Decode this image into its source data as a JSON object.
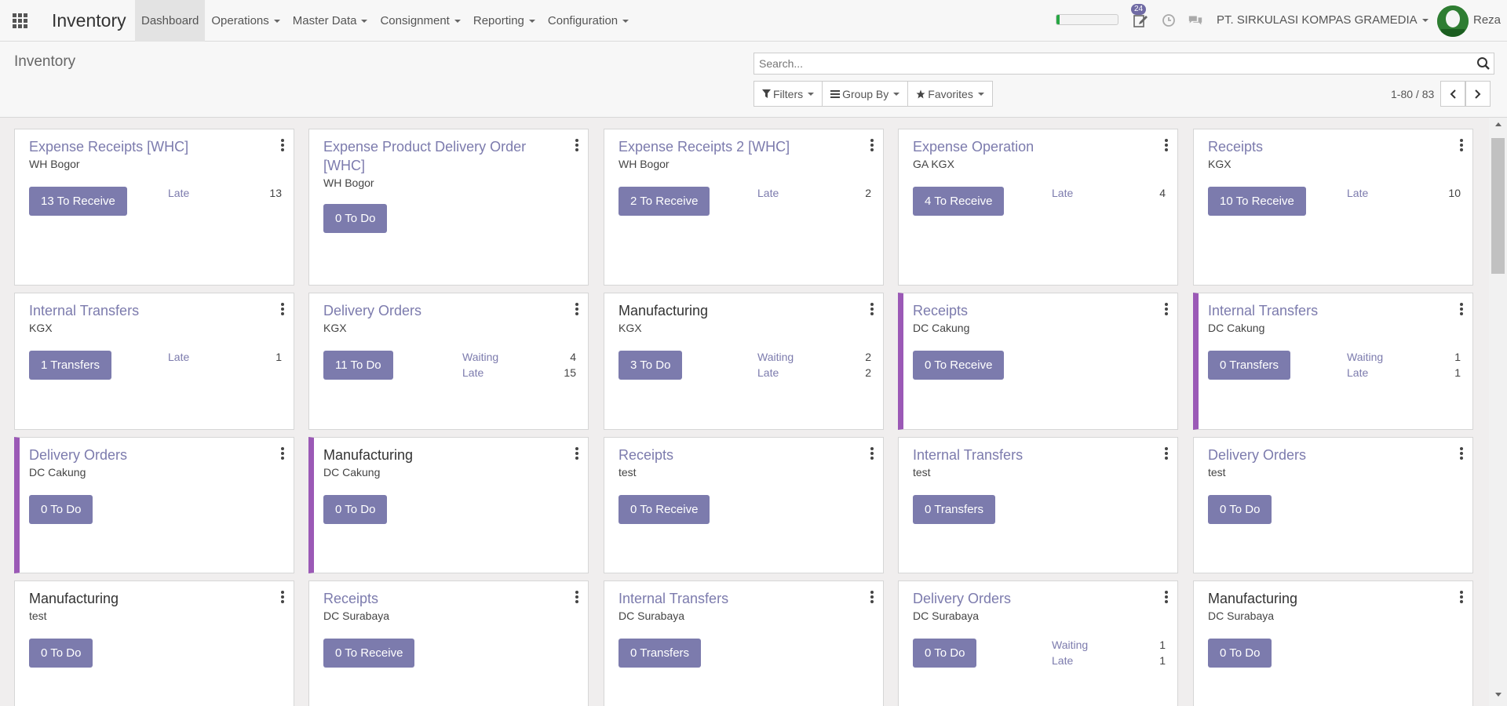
{
  "navbar": {
    "brand": "Inventory",
    "menu": [
      {
        "label": "Dashboard",
        "active": true,
        "dropdown": false
      },
      {
        "label": "Operations",
        "dropdown": true
      },
      {
        "label": "Master Data",
        "dropdown": true
      },
      {
        "label": "Consignment",
        "dropdown": true
      },
      {
        "label": "Reporting",
        "dropdown": true
      },
      {
        "label": "Configuration",
        "dropdown": true
      }
    ],
    "activity_badge": "24",
    "progress": 0.05,
    "company": "PT. SIRKULASI KOMPAS GRAMEDIA",
    "user": "Reza"
  },
  "control_panel": {
    "title": "Inventory",
    "search_placeholder": "Search...",
    "filters_label": "Filters",
    "groupby_label": "Group By",
    "favorites_label": "Favorites",
    "pager": "1-80 / 83"
  },
  "colors": {
    "accent": "#7c7bad",
    "stripe": "#9b59b6",
    "brand_green": "#28a745"
  },
  "cards": [
    {
      "title": "Expense Receipts [WHC]",
      "subtitle": "WH Bogor",
      "button": "13 To Receive",
      "stats": [
        {
          "label": "Late",
          "value": "13"
        }
      ]
    },
    {
      "title": "Expense Product Delivery Order [WHC]",
      "subtitle": "WH Bogor",
      "button": "0 To Do",
      "stats": []
    },
    {
      "title": "Expense Receipts 2 [WHC]",
      "subtitle": "WH Bogor",
      "button": "2 To Receive",
      "stats": [
        {
          "label": "Late",
          "value": "2"
        }
      ]
    },
    {
      "title": "Expense Operation",
      "subtitle": "GA KGX",
      "button": "4 To Receive",
      "stats": [
        {
          "label": "Late",
          "value": "4"
        }
      ]
    },
    {
      "title": "Receipts",
      "subtitle": "KGX",
      "button": "10 To Receive",
      "stats": [
        {
          "label": "Late",
          "value": "10"
        }
      ]
    },
    {
      "title": "Internal Transfers",
      "subtitle": "KGX",
      "button": "1 Transfers",
      "stats": [
        {
          "label": "Late",
          "value": "1"
        }
      ]
    },
    {
      "title": "Delivery Orders",
      "subtitle": "KGX",
      "button": "11 To Do",
      "stats": [
        {
          "label": "Waiting",
          "value": "4"
        },
        {
          "label": "Late",
          "value": "15"
        }
      ]
    },
    {
      "title": "Manufacturing",
      "subtitle": "KGX",
      "button": "3 To Do",
      "dark": true,
      "stats": [
        {
          "label": "Waiting",
          "value": "2"
        },
        {
          "label": "Late",
          "value": "2"
        }
      ]
    },
    {
      "title": "Receipts",
      "subtitle": "DC Cakung",
      "button": "0 To Receive",
      "accent": true,
      "stats": []
    },
    {
      "title": "Internal Transfers",
      "subtitle": "DC Cakung",
      "button": "0 Transfers",
      "accent": true,
      "stats": [
        {
          "label": "Waiting",
          "value": "1"
        },
        {
          "label": "Late",
          "value": "1"
        }
      ]
    },
    {
      "title": "Delivery Orders",
      "subtitle": "DC Cakung",
      "button": "0 To Do",
      "accent": true,
      "stats": []
    },
    {
      "title": "Manufacturing",
      "subtitle": "DC Cakung",
      "button": "0 To Do",
      "accent": true,
      "dark": true,
      "stats": []
    },
    {
      "title": "Receipts",
      "subtitle": "test",
      "button": "0 To Receive",
      "stats": []
    },
    {
      "title": "Internal Transfers",
      "subtitle": "test",
      "button": "0 Transfers",
      "stats": []
    },
    {
      "title": "Delivery Orders",
      "subtitle": "test",
      "button": "0 To Do",
      "stats": []
    },
    {
      "title": "Manufacturing",
      "subtitle": "test",
      "button": "0 To Do",
      "dark": true,
      "stats": []
    },
    {
      "title": "Receipts",
      "subtitle": "DC Surabaya",
      "button": "0 To Receive",
      "stats": []
    },
    {
      "title": "Internal Transfers",
      "subtitle": "DC Surabaya",
      "button": "0 Transfers",
      "stats": []
    },
    {
      "title": "Delivery Orders",
      "subtitle": "DC Surabaya",
      "button": "0 To Do",
      "stats": [
        {
          "label": "Waiting",
          "value": "1"
        },
        {
          "label": "Late",
          "value": "1"
        }
      ]
    },
    {
      "title": "Manufacturing",
      "subtitle": "DC Surabaya",
      "button": "0 To Do",
      "dark": true,
      "stats": []
    }
  ]
}
